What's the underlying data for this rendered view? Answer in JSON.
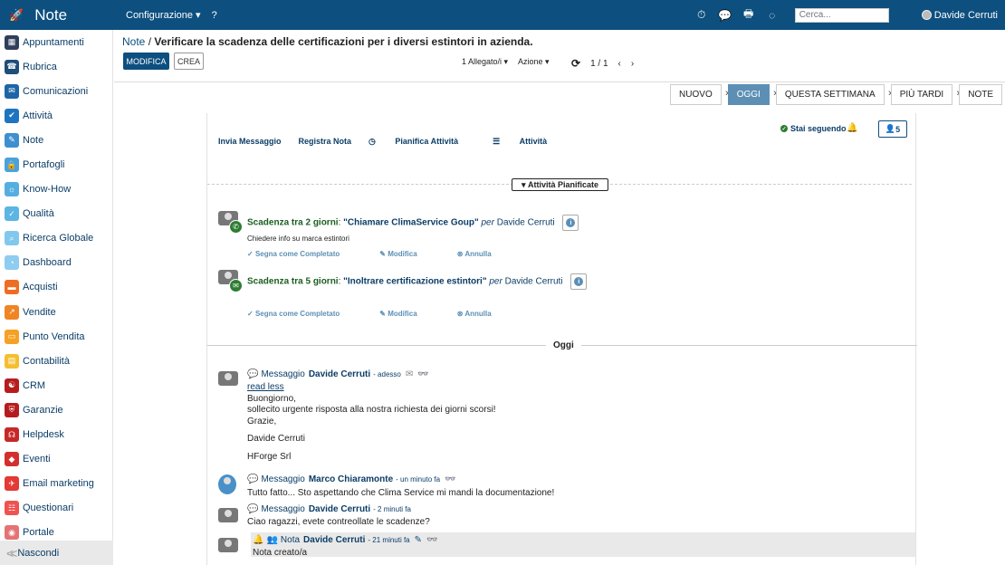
{
  "topbar": {
    "app_title": "Note",
    "menu_config": "Configurazione ▾",
    "menu_help": "?",
    "search_placeholder": "Cerca...",
    "user_name": "Davide Cerruti"
  },
  "sidebar": {
    "items": [
      {
        "label": "Appuntamenti",
        "color": "#2f3f5b"
      },
      {
        "label": "Rubrica",
        "color": "#1f4e79"
      },
      {
        "label": "Comunicazioni",
        "color": "#1e66a6"
      },
      {
        "label": "Attività",
        "color": "#1d74c0"
      },
      {
        "label": "Note",
        "color": "#3d8fd0"
      },
      {
        "label": "Portafogli",
        "color": "#4aa1db"
      },
      {
        "label": "Know-How",
        "color": "#56aee0"
      },
      {
        "label": "Qualità",
        "color": "#5cb5e3"
      },
      {
        "label": "Ricerca Globale",
        "color": "#82c8ec"
      },
      {
        "label": "Dashboard",
        "color": "#8ecdf0"
      },
      {
        "label": "Acquisti",
        "color": "#ef6c23"
      },
      {
        "label": "Vendite",
        "color": "#f08423"
      },
      {
        "label": "Punto Vendita",
        "color": "#f5a125"
      },
      {
        "label": "Contabilità",
        "color": "#f6be2e"
      },
      {
        "label": "CRM",
        "color": "#b71c1c"
      },
      {
        "label": "Garanzie",
        "color": "#b71c1c"
      },
      {
        "label": "Helpdesk",
        "color": "#c62828"
      },
      {
        "label": "Eventi",
        "color": "#d32f2f"
      },
      {
        "label": "Email marketing",
        "color": "#e53935"
      },
      {
        "label": "Questionari",
        "color": "#ef5350"
      },
      {
        "label": "Portale",
        "color": "#e57373"
      }
    ],
    "hide_label": "Nascondi"
  },
  "header": {
    "breadcrumb_root": "Note",
    "breadcrumb_sep": "/",
    "title": "Verificare la scadenza delle certificazioni per i diversi estintori in azienda.",
    "btn_edit": "MODIFICA",
    "btn_create": "CREA",
    "attachments": "1 Allegato/i ▾",
    "actions": "Azione ▾",
    "pager": "1 / 1"
  },
  "stages": [
    "NUOVO",
    "OGGI",
    "QUESTA SETTIMANA",
    "PIÙ TARDI",
    "NOTE"
  ],
  "chatter": {
    "tabs": [
      "Invia Messaggio",
      "Registra Nota",
      "Pianifica Attività",
      "Attività"
    ],
    "following": "Stai seguendo",
    "followers_count": "5",
    "planned_label": "Attività Pianificate",
    "activities": [
      {
        "due": "Scadenza tra 2 giorni",
        "summary": "\"Chiamare ClimaService Goup\"",
        "per": "per",
        "user": "Davide Cerruti",
        "note": "Chiedere info su marca estintori",
        "done": "Segna come Completato",
        "edit": "Modifica",
        "cancel": "Annulla"
      },
      {
        "due": "Scadenza tra 5 giorni",
        "summary": "\"Inoltrare certificazione estintori\"",
        "per": "per",
        "user": "Davide Cerruti",
        "note": "",
        "done": "Segna come Completato",
        "edit": "Modifica",
        "cancel": "Annulla"
      }
    ],
    "today_label": "Oggi",
    "messages": [
      {
        "type": "Messaggio",
        "author": "Davide Cerruti",
        "time": "- adesso",
        "read_less": "read less",
        "lines": [
          "Buongiorno,",
          "sollecito urgente risposta alla nostra richiesta dei giorni scorsi!",
          "Grazie,",
          "Davide Cerruti",
          "HForge Srl"
        ]
      },
      {
        "type": "Messaggio",
        "author": "Marco Chiaramonte",
        "time": "- un minuto fa",
        "body": "Tutto fatto... Sto aspettando che Clima Service mi mandi la documentazione!"
      },
      {
        "type": "Messaggio",
        "author": "Davide Cerruti",
        "time": "- 2 minuti fa",
        "body": "Ciao ragazzi, evete contreollate le scadenze?"
      },
      {
        "type": "Nota",
        "author": "Davide Cerruti",
        "time": "- 21 minuti fa",
        "body": "Nota creato/a"
      }
    ]
  }
}
